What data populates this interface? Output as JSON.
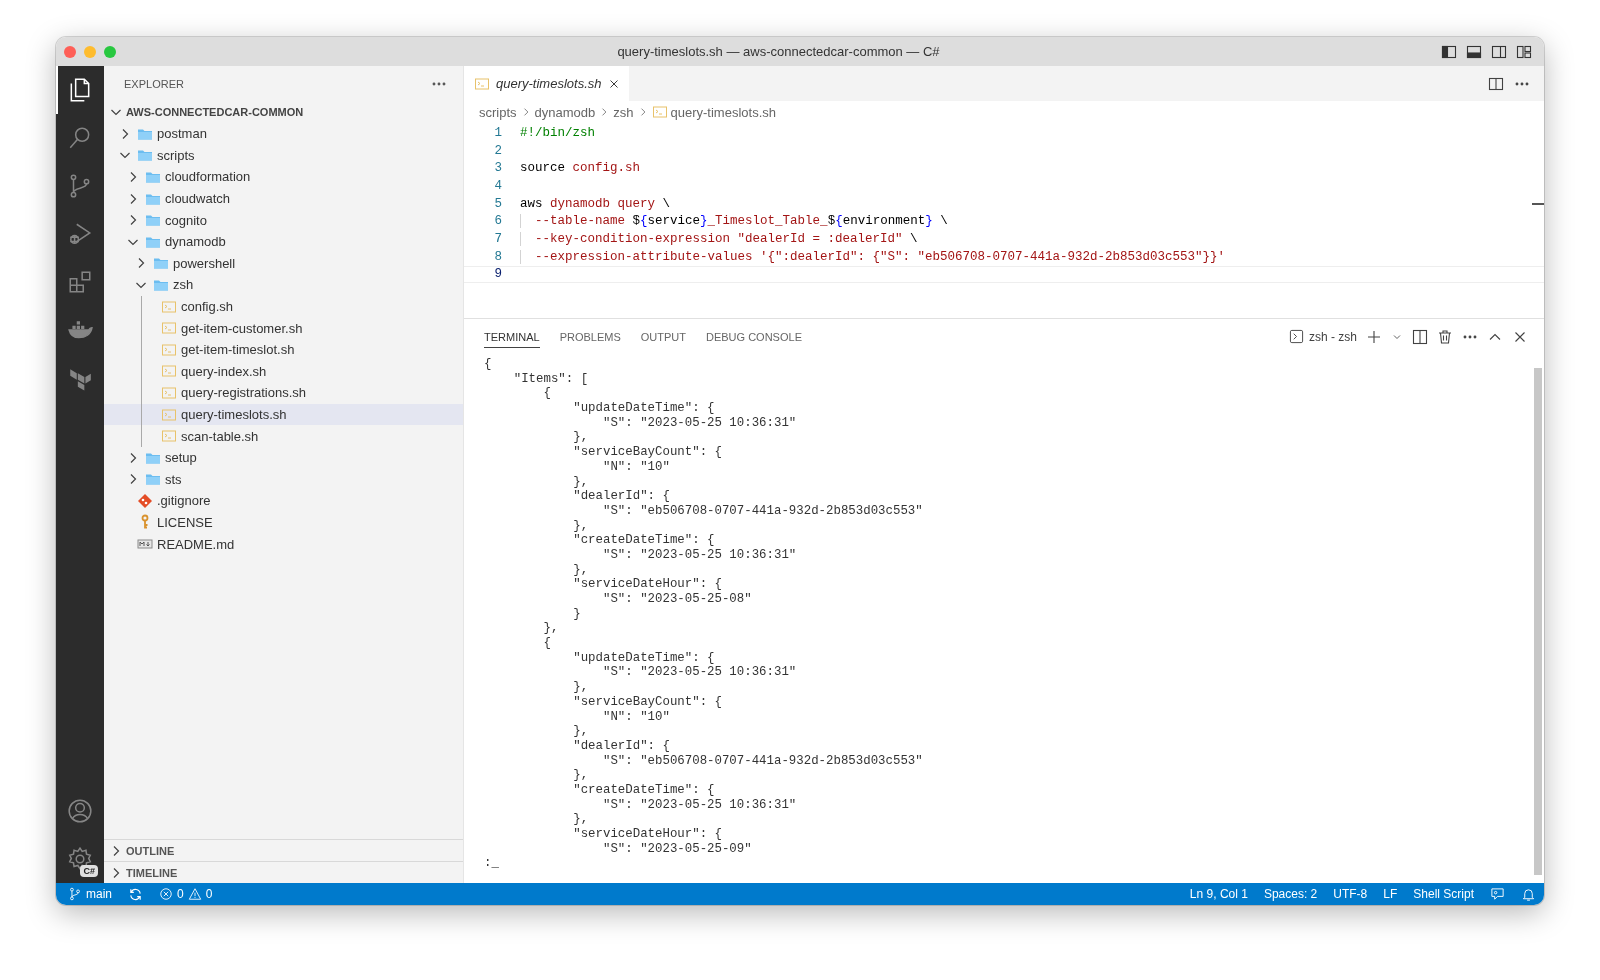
{
  "window": {
    "title": "query-timeslots.sh — aws-connectedcar-common — C#"
  },
  "activity_bar": {
    "top": [
      {
        "kind": "explorer",
        "selected": true
      },
      {
        "kind": "search",
        "selected": false
      },
      {
        "kind": "source-control",
        "selected": false
      },
      {
        "kind": "run-debug",
        "selected": false
      },
      {
        "kind": "extensions",
        "selected": false
      },
      {
        "kind": "docker",
        "selected": false
      },
      {
        "kind": "terraform",
        "selected": false
      }
    ],
    "bottom": [
      {
        "kind": "account",
        "selected": false
      },
      {
        "kind": "settings",
        "selected": false,
        "badge": "C#"
      }
    ]
  },
  "explorer": {
    "title": "EXPLORER",
    "root": {
      "label": "AWS-CONNECTEDCAR-COMMON",
      "expanded": true,
      "children": [
        {
          "label": "postman",
          "kind": "folder",
          "expanded": false,
          "selected": false
        },
        {
          "label": "scripts",
          "kind": "folder",
          "expanded": true,
          "selected": false,
          "children": [
            {
              "label": "cloudformation",
              "kind": "folder",
              "expanded": false,
              "selected": false
            },
            {
              "label": "cloudwatch",
              "kind": "folder",
              "expanded": false,
              "selected": false
            },
            {
              "label": "cognito",
              "kind": "folder",
              "expanded": false,
              "selected": false
            },
            {
              "label": "dynamodb",
              "kind": "folder",
              "expanded": true,
              "selected": false,
              "children": [
                {
                  "label": "powershell",
                  "kind": "folder",
                  "expanded": false,
                  "selected": false
                },
                {
                  "label": "zsh",
                  "kind": "folder",
                  "expanded": true,
                  "selected": false,
                  "children": [
                    {
                      "label": "config.sh",
                      "kind": "shell",
                      "selected": false
                    },
                    {
                      "label": "get-item-customer.sh",
                      "kind": "shell",
                      "selected": false
                    },
                    {
                      "label": "get-item-timeslot.sh",
                      "kind": "shell",
                      "selected": false
                    },
                    {
                      "label": "query-index.sh",
                      "kind": "shell",
                      "selected": false
                    },
                    {
                      "label": "query-registrations.sh",
                      "kind": "shell",
                      "selected": false
                    },
                    {
                      "label": "query-timeslots.sh",
                      "kind": "shell",
                      "selected": true
                    },
                    {
                      "label": "scan-table.sh",
                      "kind": "shell",
                      "selected": false
                    }
                  ]
                }
              ]
            },
            {
              "label": "setup",
              "kind": "folder",
              "expanded": false,
              "selected": false
            },
            {
              "label": "sts",
              "kind": "folder",
              "expanded": false,
              "selected": false
            }
          ]
        },
        {
          "label": ".gitignore",
          "kind": "git",
          "selected": false
        },
        {
          "label": "LICENSE",
          "kind": "license",
          "selected": false
        },
        {
          "label": "README.md",
          "kind": "markdown",
          "selected": false
        }
      ]
    }
  },
  "sidebar_sections": [
    {
      "label": "OUTLINE",
      "expanded": false
    },
    {
      "label": "TIMELINE",
      "expanded": false
    }
  ],
  "editor": {
    "tabs": [
      {
        "label": "query-timeslots.sh",
        "selected": true
      }
    ],
    "breadcrumb": [
      "scripts",
      "dynamodb",
      "zsh",
      "query-timeslots.sh"
    ],
    "lines": [
      {
        "number": "1",
        "selected": false,
        "indented": false,
        "tokens": [
          {
            "text": "#!/bin/zsh",
            "kind": "comment"
          }
        ]
      },
      {
        "number": "2",
        "selected": false
      },
      {
        "number": "3",
        "selected": false,
        "indented": false,
        "tokens": [
          {
            "text": "source ",
            "kind": "plain"
          },
          {
            "text": "config.sh",
            "kind": "string"
          }
        ]
      },
      {
        "number": "4",
        "selected": false
      },
      {
        "number": "5",
        "selected": false,
        "indented": false,
        "tokens": [
          {
            "text": "aws ",
            "kind": "plain"
          },
          {
            "text": "dynamodb query",
            "kind": "string"
          },
          {
            "text": " \\",
            "kind": "plain"
          }
        ]
      },
      {
        "number": "6",
        "selected": false,
        "indented": true,
        "tokens": [
          {
            "text": "--table-name ",
            "kind": "string"
          },
          {
            "text": "$",
            "kind": "plain"
          },
          {
            "text": "{",
            "kind": "brace"
          },
          {
            "text": "service",
            "kind": "plain"
          },
          {
            "text": "}",
            "kind": "brace"
          },
          {
            "text": "_Timeslot_Table_",
            "kind": "string"
          },
          {
            "text": "$",
            "kind": "plain"
          },
          {
            "text": "{",
            "kind": "brace"
          },
          {
            "text": "environment",
            "kind": "plain"
          },
          {
            "text": "}",
            "kind": "brace"
          },
          {
            "text": " \\",
            "kind": "plain"
          }
        ]
      },
      {
        "number": "7",
        "selected": false,
        "indented": true,
        "tokens": [
          {
            "text": "--key-condition-expression \"dealerId = :dealerId\"",
            "kind": "string"
          },
          {
            "text": " \\",
            "kind": "plain"
          }
        ]
      },
      {
        "number": "8",
        "selected": false,
        "indented": true,
        "tokens": [
          {
            "text": "--expression-attribute-values '{\":dealerId\": {\"S\": \"eb506708-0707-441a-932d-2b853d03c553\"}}'",
            "kind": "string"
          }
        ]
      },
      {
        "number": "9",
        "selected": true
      }
    ]
  },
  "panel": {
    "tabs": [
      {
        "label": "TERMINAL",
        "selected": true
      },
      {
        "label": "PROBLEMS",
        "selected": false
      },
      {
        "label": "OUTPUT",
        "selected": false
      },
      {
        "label": "DEBUG CONSOLE",
        "selected": false
      }
    ],
    "terminal_name": "zsh - zsh",
    "terminal_lines": [
      "{",
      "    \"Items\": [",
      "        {",
      "            \"updateDateTime\": {",
      "                \"S\": \"2023-05-25 10:36:31\"",
      "            },",
      "            \"serviceBayCount\": {",
      "                \"N\": \"10\"",
      "            },",
      "            \"dealerId\": {",
      "                \"S\": \"eb506708-0707-441a-932d-2b853d03c553\"",
      "            },",
      "            \"createDateTime\": {",
      "                \"S\": \"2023-05-25 10:36:31\"",
      "            },",
      "            \"serviceDateHour\": {",
      "                \"S\": \"2023-05-25-08\"",
      "            }",
      "        },",
      "        {",
      "            \"updateDateTime\": {",
      "                \"S\": \"2023-05-25 10:36:31\"",
      "            },",
      "            \"serviceBayCount\": {",
      "                \"N\": \"10\"",
      "            },",
      "            \"dealerId\": {",
      "                \"S\": \"eb506708-0707-441a-932d-2b853d03c553\"",
      "            },",
      "            \"createDateTime\": {",
      "                \"S\": \"2023-05-25 10:36:31\"",
      "            },",
      "            \"serviceDateHour\": {",
      "                \"S\": \"2023-05-25-09\"",
      ":_"
    ]
  },
  "status_bar": {
    "branch": "main",
    "errors": "0",
    "warnings": "0",
    "right": [
      "Ln 9, Col 1",
      "Spaces: 2",
      "UTF-8",
      "LF",
      "Shell Script"
    ]
  }
}
